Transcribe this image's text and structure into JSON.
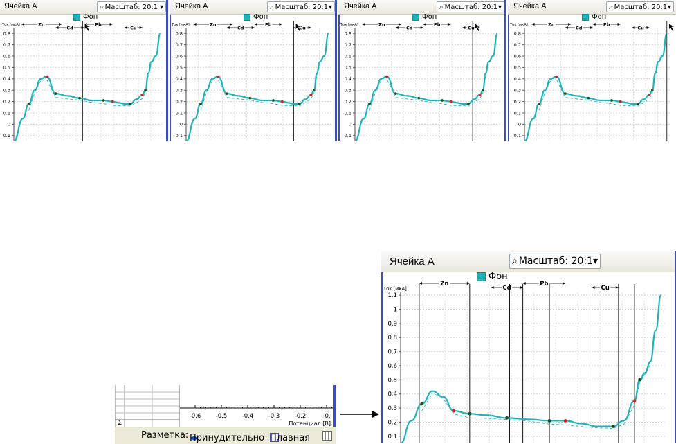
{
  "panels": [
    {
      "title": "Ячейка А",
      "scale_label": "Масштаб:",
      "scale_value": "20:1",
      "legend": "Фон",
      "segments": [
        "Zn",
        "Cd",
        "Pb",
        "Cu"
      ],
      "y_axis_label": "Ток [мкА]",
      "y_ticks": [
        "0.8",
        "0.7",
        "0.6",
        "0.5",
        "0.4",
        "0.3",
        "0.2",
        "0.1",
        "0",
        "-0.1"
      ]
    },
    {
      "title": "Ячейка А",
      "scale_label": "Масштаб:",
      "scale_value": "20:1",
      "legend": "Фон",
      "segments": [
        "Zn",
        "Cd",
        "Pb",
        "Cu"
      ],
      "y_axis_label": "Ток [мкА]",
      "y_ticks": [
        "0.8",
        "0.7",
        "0.6",
        "0.5",
        "0.4",
        "0.3",
        "0.2",
        "0.1",
        "0",
        "-0.1"
      ]
    },
    {
      "title": "Ячейка А",
      "scale_label": "Масштаб:",
      "scale_value": "20:1",
      "legend": "Фон",
      "segments": [
        "Zn",
        "Cd",
        "Pb",
        "Cu"
      ],
      "y_axis_label": "Ток [мкА]",
      "y_ticks": [
        "0.8",
        "0.7",
        "0.6",
        "0.5",
        "0.4",
        "0.3",
        "0.2",
        "0.1",
        "0",
        "-0.1"
      ]
    },
    {
      "title": "Ячейка А",
      "scale_label": "Масштаб:",
      "scale_value": "20:1",
      "legend": "Фон",
      "segments": [
        "Zn",
        "Cd",
        "Pb",
        "Cu"
      ],
      "y_axis_label": "Ток [мкА]",
      "y_ticks": [
        "0.8",
        "0.7",
        "0.6",
        "0.5",
        "0.4",
        "0.3",
        "0.2",
        "0.1",
        "0",
        "-0.1"
      ]
    }
  ],
  "main_panel": {
    "title": "Ячейка А",
    "scale_label": "Масштаб:",
    "scale_value": "20:1",
    "legend": "Фон",
    "segments": [
      "Zn",
      "Cd",
      "Pb",
      "Cu"
    ],
    "y_axis_label": "Ток [мкА]",
    "y_ticks": [
      "1.1",
      "1",
      "0.9",
      "0.8",
      "0.7",
      "0.6",
      "0.5",
      "0.4",
      "0.3",
      "0.2",
      "0.1"
    ]
  },
  "mini_panel": {
    "x_ticks": [
      "-0.6",
      "-0.5",
      "-0.4",
      "-0.3",
      "-0.2",
      "-0."
    ],
    "x_axis_label": "Потенциал [В]",
    "sigma": "Σ"
  },
  "toolbar": {
    "razmetka_label": "Разметка:",
    "forced_label": "Принудительно",
    "smooth_label": "Плавная"
  },
  "colors": {
    "curve": "#1fb2b8",
    "frame": "#3c4fb4",
    "marker_red": "#d62020",
    "marker_dark": "#1e4d1e",
    "marker_orange": "#f0a020"
  },
  "chart_data": [
    {
      "type": "line",
      "title": "Ячейка А",
      "ylabel": "Ток [мкА]",
      "ylim": [
        -0.15,
        0.85
      ],
      "series": [
        {
          "name": "Фон",
          "x": [
            0.0,
            0.06,
            0.1,
            0.14,
            0.18,
            0.22,
            0.28,
            0.36,
            0.44,
            0.52,
            0.6,
            0.66,
            0.7,
            0.74,
            0.78,
            0.82,
            0.86,
            0.88,
            0.9,
            0.92,
            0.95,
            0.98
          ],
          "y": [
            -0.15,
            0.05,
            0.18,
            0.3,
            0.4,
            0.42,
            0.27,
            0.25,
            0.23,
            0.21,
            0.21,
            0.2,
            0.19,
            0.18,
            0.18,
            0.22,
            0.26,
            0.3,
            0.45,
            0.55,
            0.6,
            0.8
          ]
        }
      ],
      "cursor_x": 0.46
    },
    {
      "type": "line",
      "title": "Ячейка А",
      "ylabel": "Ток [мкА]",
      "ylim": [
        -0.15,
        0.85
      ],
      "series": [
        {
          "name": "Фон",
          "x": [
            0.0,
            0.06,
            0.1,
            0.14,
            0.18,
            0.22,
            0.28,
            0.36,
            0.44,
            0.52,
            0.6,
            0.66,
            0.7,
            0.74,
            0.78,
            0.82,
            0.86,
            0.88,
            0.9,
            0.92,
            0.95,
            0.98
          ],
          "y": [
            -0.15,
            0.05,
            0.18,
            0.3,
            0.4,
            0.42,
            0.27,
            0.25,
            0.23,
            0.21,
            0.21,
            0.2,
            0.19,
            0.18,
            0.18,
            0.22,
            0.26,
            0.3,
            0.45,
            0.55,
            0.6,
            0.8
          ]
        }
      ],
      "cursor_x": 0.74
    },
    {
      "type": "line",
      "title": "Ячейка А",
      "ylabel": "Ток [мкА]",
      "ylim": [
        -0.15,
        0.85
      ],
      "series": [
        {
          "name": "Фон",
          "x": [
            0.0,
            0.06,
            0.1,
            0.14,
            0.18,
            0.22,
            0.28,
            0.36,
            0.44,
            0.52,
            0.6,
            0.66,
            0.7,
            0.74,
            0.78,
            0.82,
            0.86,
            0.88,
            0.9,
            0.92,
            0.95,
            0.98
          ],
          "y": [
            -0.15,
            0.05,
            0.18,
            0.3,
            0.4,
            0.42,
            0.27,
            0.25,
            0.23,
            0.21,
            0.21,
            0.2,
            0.19,
            0.18,
            0.18,
            0.22,
            0.26,
            0.3,
            0.45,
            0.55,
            0.6,
            0.8
          ]
        }
      ],
      "cursor_x": 0.81
    },
    {
      "type": "line",
      "title": "Ячейка А",
      "ylabel": "Ток [мкА]",
      "ylim": [
        -0.15,
        0.85
      ],
      "series": [
        {
          "name": "Фон",
          "x": [
            0.0,
            0.06,
            0.1,
            0.14,
            0.18,
            0.22,
            0.28,
            0.36,
            0.44,
            0.52,
            0.6,
            0.66,
            0.7,
            0.74,
            0.78,
            0.82,
            0.86,
            0.88,
            0.9,
            0.92,
            0.95,
            0.98
          ],
          "y": [
            -0.15,
            0.05,
            0.18,
            0.3,
            0.4,
            0.42,
            0.27,
            0.25,
            0.23,
            0.21,
            0.21,
            0.2,
            0.19,
            0.18,
            0.18,
            0.22,
            0.26,
            0.3,
            0.45,
            0.55,
            0.6,
            0.8
          ]
        }
      ],
      "cursor_x": 0.98
    },
    {
      "type": "line",
      "title": "Ячейка А",
      "ylabel": "Ток [мкА]",
      "ylim": [
        0.05,
        1.12
      ],
      "series": [
        {
          "name": "Фон",
          "x": [
            0.0,
            0.04,
            0.08,
            0.12,
            0.16,
            0.2,
            0.26,
            0.32,
            0.4,
            0.48,
            0.56,
            0.62,
            0.68,
            0.74,
            0.8,
            0.84,
            0.88,
            0.9,
            0.92,
            0.94,
            0.96,
            0.98
          ],
          "y": [
            0.05,
            0.21,
            0.33,
            0.42,
            0.38,
            0.28,
            0.26,
            0.25,
            0.23,
            0.22,
            0.21,
            0.21,
            0.19,
            0.17,
            0.17,
            0.21,
            0.35,
            0.5,
            0.55,
            0.63,
            0.85,
            1.1
          ]
        }
      ],
      "dividers_x": [
        0.07,
        0.26,
        0.34,
        0.41,
        0.46,
        0.56,
        0.72,
        0.82,
        0.88
      ]
    }
  ]
}
